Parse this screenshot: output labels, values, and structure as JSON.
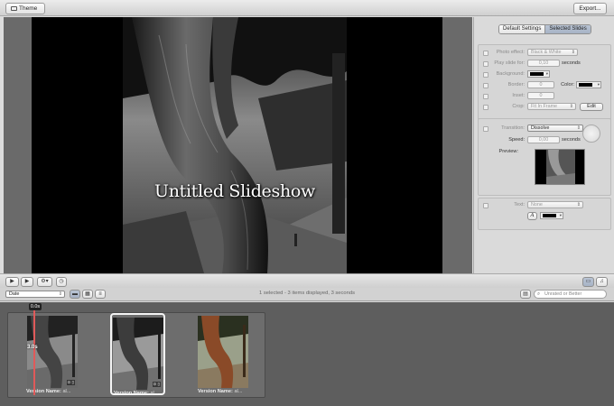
{
  "topbar": {
    "theme_label": "Theme",
    "export_label": "Export..."
  },
  "slide": {
    "title": "Untitled Slideshow"
  },
  "inspector": {
    "tabs": [
      "Default Settings",
      "Selected Slides"
    ],
    "photo_effect": {
      "label": "Photo effect:",
      "value": "Black & White"
    },
    "play_slide": {
      "label": "Play slide for:",
      "value": "0,10",
      "unit": "seconds"
    },
    "background": {
      "label": "Background:"
    },
    "border": {
      "label": "Border:",
      "value": "0"
    },
    "color": {
      "label": "Color:"
    },
    "inset": {
      "label": "Inset:",
      "value": "0"
    },
    "crop": {
      "label": "Crop:",
      "value": "Fit In Frame",
      "edit_label": "Edit"
    },
    "transition": {
      "label": "Transition:",
      "value": "Dissolve"
    },
    "speed": {
      "label": "Speed:",
      "value": "0,00",
      "unit": "seconds"
    },
    "preview": {
      "label": "Preview:"
    },
    "text": {
      "label": "Text:",
      "value": "None",
      "font_button": "A"
    }
  },
  "sort": {
    "value": "Date"
  },
  "status": "1 selected - 3 items displayed, 3 seconds",
  "search": {
    "placeholder": "Unrated or Better"
  },
  "timeline": {
    "top_duration": "0.0s",
    "slide_duration": "3.0s"
  },
  "slides": [
    {
      "name_label": "Version Name:",
      "name_value": "al..."
    },
    {
      "name_label": "Version Name:",
      "name_value": "al..."
    },
    {
      "name_label": "Version Name:",
      "name_value": "al..."
    }
  ],
  "colors": {
    "accent": "#a7b3c6",
    "playhead": "#e05a5a"
  }
}
